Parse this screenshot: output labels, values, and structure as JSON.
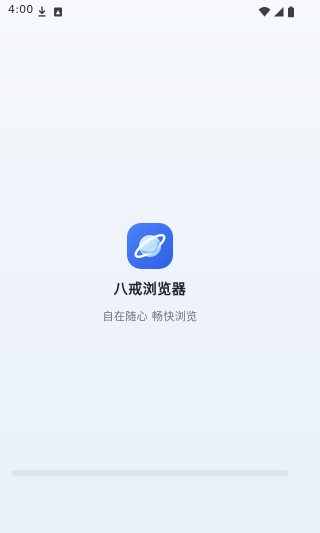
{
  "status_bar": {
    "time": "4:00",
    "left_icons": [
      "download-icon",
      "notification-icon"
    ],
    "right_icons": [
      "wifi-icon",
      "signal-icon",
      "battery-icon"
    ]
  },
  "splash": {
    "app_name": "八戒浏览器",
    "slogan": "自在随心 畅快浏览",
    "logo_icon": "planet-logo-icon"
  },
  "colors": {
    "background_top": "#f6f8fc",
    "background_bottom": "#e9f0f9",
    "logo_blue": "#3d6ff2",
    "logo_ring": "#ffffff"
  }
}
